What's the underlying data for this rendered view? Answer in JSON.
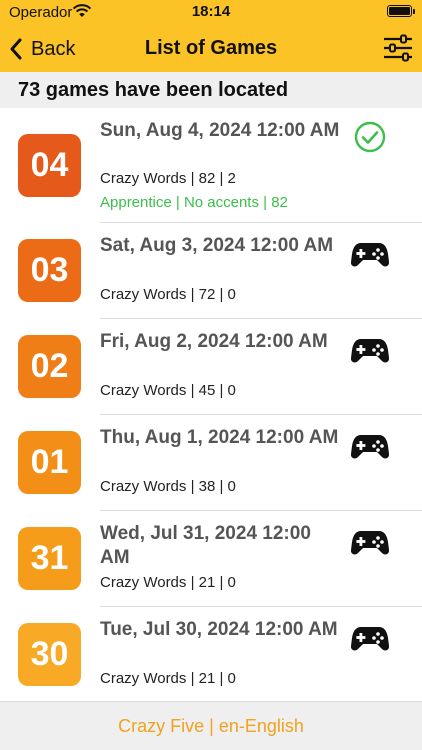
{
  "status_bar": {
    "carrier": "Operador",
    "time": "18:14"
  },
  "nav": {
    "back_label": "Back",
    "title": "List of Games",
    "filter_icon": "sliders-icon"
  },
  "summary": {
    "text": "73 games have been located"
  },
  "colors": {
    "topbar": "#fbc326",
    "success": "#3bbf4a",
    "footer_text": "#f2a21e"
  },
  "games": [
    {
      "badge": "04",
      "badge_color": "#e5591a",
      "title": "Sun, Aug 4, 2024 12:00 AM",
      "details": "Crazy Words | 82 | 2",
      "extra": "Apprentice | No accents | 82",
      "status_icon": "check-circle-icon"
    },
    {
      "badge": "03",
      "badge_color": "#ec6b17",
      "title": "Sat, Aug 3, 2024 12:00 AM",
      "details": "Crazy Words | 72 | 0",
      "extra": "",
      "status_icon": "gamepad-icon"
    },
    {
      "badge": "02",
      "badge_color": "#f07e16",
      "title": "Fri, Aug 2, 2024 12:00 AM",
      "details": "Crazy Words | 45 | 0",
      "extra": "",
      "status_icon": "gamepad-icon"
    },
    {
      "badge": "01",
      "badge_color": "#f38f17",
      "title": "Thu, Aug 1, 2024 12:00 AM",
      "details": "Crazy Words | 38 | 0",
      "extra": "",
      "status_icon": "gamepad-icon"
    },
    {
      "badge": "31",
      "badge_color": "#f59c1b",
      "title": "Wed, Jul 31, 2024 12:00 AM",
      "details": "Crazy Words | 21 | 0",
      "extra": "",
      "status_icon": "gamepad-icon"
    },
    {
      "badge": "30",
      "badge_color": "#f8a925",
      "title": "Tue, Jul 30, 2024 12:00 AM",
      "details": "Crazy Words | 21 | 0",
      "extra": "",
      "status_icon": "gamepad-icon"
    }
  ],
  "footer": {
    "text": "Crazy Five | en-English"
  }
}
